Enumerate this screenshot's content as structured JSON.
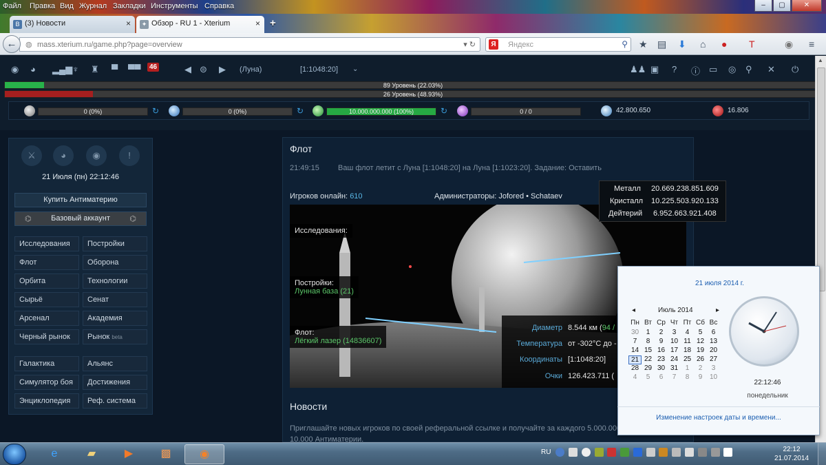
{
  "browser": {
    "menu": [
      "Файл",
      "Правка",
      "Вид",
      "Журнал",
      "Закладки",
      "Инструменты",
      "Справка"
    ],
    "tabs": [
      {
        "title": "(3) Новости",
        "icon": "vk-icon"
      },
      {
        "title": "Обзор - RU 1 - Xterium",
        "icon": "xterium-icon"
      }
    ],
    "new_tab": "+",
    "url": "mass.xterium.ru/game.php?page=overview",
    "search_placeholder": "Яндекс",
    "search_logo": "Я",
    "window_controls": {
      "minimize": "–",
      "restore": "▢",
      "close": "✕"
    }
  },
  "game": {
    "unread_messages": "46",
    "planet_name": "(Луна)",
    "planet_coords": "[1:1048:20]",
    "level_bar_1": {
      "label": "89 Уровень (22.03%)",
      "percent": 22.03
    },
    "level_bar_2": {
      "label": "26 Уровень (48.93%)",
      "percent": 48.93
    },
    "resources": [
      {
        "name": "metal-storage",
        "label": "0 (0%)",
        "percent": 0
      },
      {
        "name": "crystal-storage",
        "label": "0 (0%)",
        "percent": 0
      },
      {
        "name": "deuterium-storage",
        "label": "10.000.000.000 (100%)",
        "percent": 100
      },
      {
        "name": "energy",
        "label": "0 / 0",
        "percent": 0
      }
    ],
    "dark_matter": "42.800.650",
    "antimatter": "16.806"
  },
  "sidebar": {
    "datetime": "21 Июля (пн) 22:12:46",
    "buy_antimatter": "Купить Антиматерию",
    "basic_account": "Базовый аккаунт",
    "nav_left": [
      "Исследования",
      "Флот",
      "Орбита",
      "Сырьё",
      "Арсенал",
      "Черный рынок"
    ],
    "nav_right": [
      "Постройки",
      "Оборона",
      "Технологии",
      "Сенат",
      "Академия",
      "Рынок"
    ],
    "beta_tag": "beta",
    "nav2_left": [
      "Галактика",
      "Симулятор боя",
      "Энциклопедия"
    ],
    "nav2_right": [
      "Альянс",
      "Достижения",
      "Реф. система"
    ]
  },
  "main": {
    "fleet_title": "Флот",
    "fleet_time": "21:49:15",
    "fleet_message": "Ваш флот летит с Луна [1:1048:20] на Луна [1:1023:20]. Задание: Оставить",
    "online_label": "Игроков онлайн:",
    "online_count": "610",
    "admins": "Администраторы: Jofored • Schataev",
    "research_label": "Исследования:",
    "buildings_label": "Постройки:",
    "buildings_value": "Лунная база (21)",
    "fleet_label": "Флот:",
    "fleet_value": "Лёгкий лазер (14836607)",
    "planet_stats": [
      {
        "key": "Диаметр",
        "value": "8.544 км (",
        "extra": "94 /"
      },
      {
        "key": "Температура",
        "value": "от -302°C до -"
      },
      {
        "key": "Координаты",
        "value": "[1:1048:20]"
      },
      {
        "key": "Очки",
        "value": "126.423.711 ("
      }
    ],
    "news_title": "Новости",
    "news_body": "Приглашайте новых игроков по своей реферальной ссылке и получайте за каждого 5.000.000",
    "news_body2": "10.000 Антиматерии."
  },
  "resource_tooltip": [
    {
      "name": "Металл",
      "value": "20.669.238.851.609"
    },
    {
      "name": "Кристалл",
      "value": "10.225.503.920.133"
    },
    {
      "name": "Дейтерий",
      "value": "6.952.663.921.408"
    }
  ],
  "calendar": {
    "date_heading": "21 июля 2014 г.",
    "month": "Июль 2014",
    "weekdays": [
      "Пн",
      "Вт",
      "Ср",
      "Чт",
      "Пт",
      "Сб",
      "Вс"
    ],
    "weeks": [
      [
        "30",
        "1",
        "2",
        "3",
        "4",
        "5",
        "6"
      ],
      [
        "7",
        "8",
        "9",
        "10",
        "11",
        "12",
        "13"
      ],
      [
        "14",
        "15",
        "16",
        "17",
        "18",
        "19",
        "20"
      ],
      [
        "21",
        "22",
        "23",
        "24",
        "25",
        "26",
        "27"
      ],
      [
        "28",
        "29",
        "30",
        "31",
        "1",
        "2",
        "3"
      ],
      [
        "4",
        "5",
        "6",
        "7",
        "8",
        "9",
        "10"
      ]
    ],
    "today": "21",
    "time": "22:12:46",
    "weekday": "понедельник",
    "change_link": "Изменение настроек даты и времени..."
  },
  "taskbar": {
    "lang": "RU",
    "clock_time": "22:12",
    "clock_date": "21.07.2014"
  }
}
